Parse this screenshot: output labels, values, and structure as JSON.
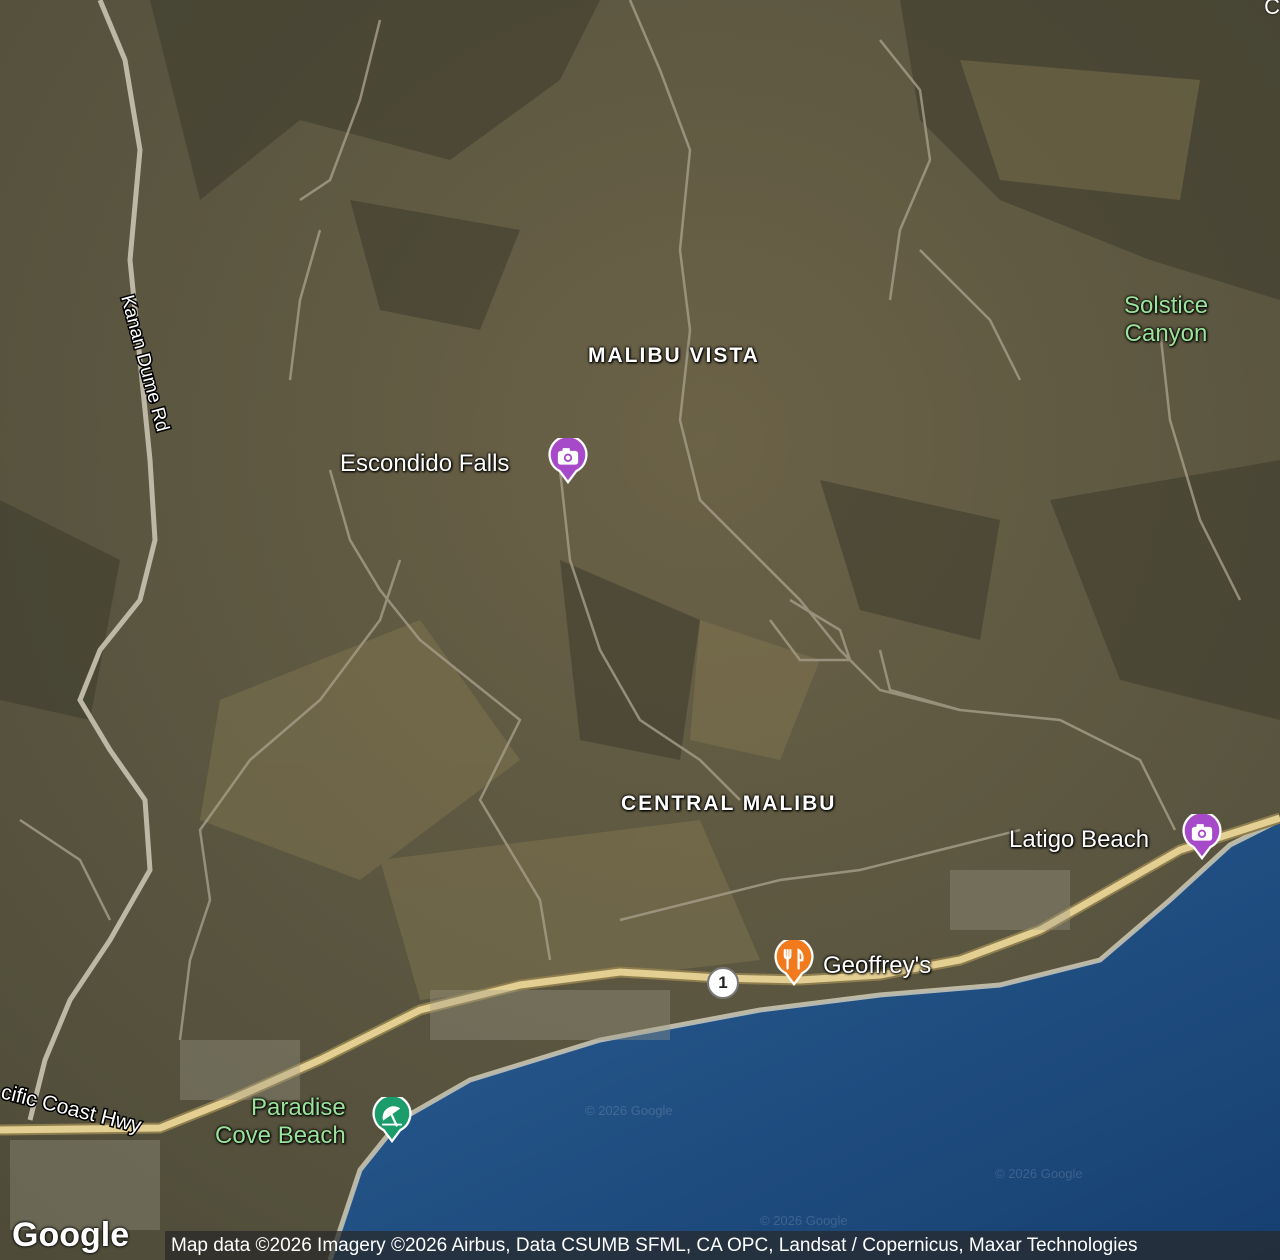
{
  "map": {
    "areas": {
      "malibu_vista": "MALIBU VISTA",
      "central_malibu": "CENTRAL MALIBU"
    },
    "roads": {
      "kanan_dume": "Kanan Dume Rd",
      "pch": "cific Coast Hwy",
      "route_shield": "1"
    },
    "pois": {
      "escondido_falls": "Escondido Falls",
      "latigo_beach": "Latigo Beach",
      "geoffreys": "Geoffrey's",
      "solstice_canyon_line1": "Solstice",
      "solstice_canyon_line2": "Canyon",
      "paradise_cove_line1": "Paradise",
      "paradise_cove_line2": "Cove Beach"
    },
    "corner_letter": "C",
    "watermark": "© 2026 Google",
    "colors": {
      "terrain": "#5a5a44",
      "ocean": "#1f4f86",
      "highway": "#e4cf92",
      "poi_camera": "#a64ac9",
      "poi_food": "#f07a1c",
      "poi_park": "#1a9c6b",
      "park_text": "#9be39b"
    },
    "icons": {
      "tourist_attraction": "camera-icon",
      "restaurant": "fork-knife-icon",
      "beach": "umbrella-icon"
    }
  },
  "footer": {
    "logo": "Google",
    "attribution": "Map data ©2026 Imagery ©2026 Airbus, Data CSUMB SFML, CA OPC, Landsat / Copernicus, Maxar Technologies"
  }
}
